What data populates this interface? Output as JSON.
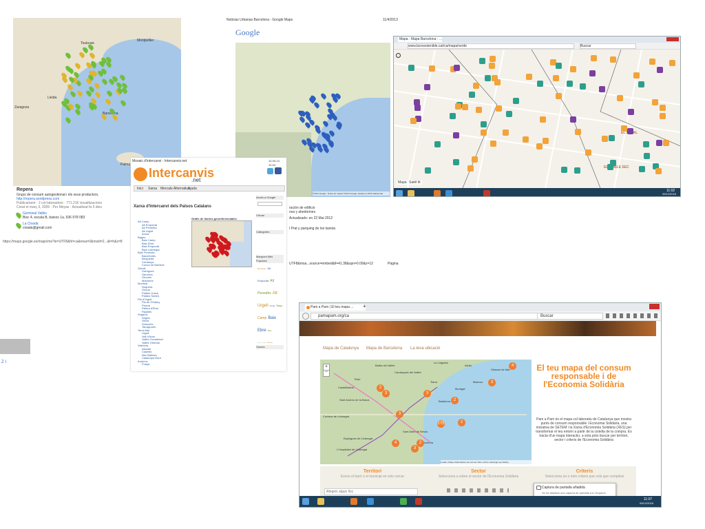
{
  "repera": {
    "map_labels": {
      "lleida": "Lleida",
      "zaragoza": "Zaragoza",
      "barcelona": "Barcelona",
      "toulouse": "Toulouse",
      "montpellier": "Montpellier",
      "palma": "Palma"
    },
    "title": "Repera",
    "desc": "Grups de consum autogestionat i els seus productors.",
    "url": "http://repera.wordpress.com",
    "meta": "Publicament · 2 col·laboradors · 771.216 visualitzacions",
    "meta2": "Creat el març 3, 2009 · Per Meyas · Actualitzat fa 5 dies",
    "item1_title": "Germinal Vallès",
    "item1_addr": "Bisc 4, escala B, baixos 1a, 936 978 083",
    "item2_title": "La Civada",
    "item2_email": "civada@gmail.com",
    "url_bar": "https://maps.google.es/maps/ms?ie=UTF8&hl=ca&msa=0&msid=2...&t=h&z=8"
  },
  "gmap_print": {
    "header_left": "Noticias Urbanas Barcelona - Google Maps",
    "header_right": "11/4/2013",
    "logo": "Google",
    "footer": "©2013 Google · Datos de mapas ©2013 Google, basado en BCN GEOportal",
    "notes": [
      "ración de edificio",
      "ova y ahedorines",
      "Actualizado: en 22 Mai 2012",
      "l Prat y parquing de los taxista"
    ],
    "url_line": "UTF8&msa...source=embed&ll=41.38&spn=0.09&z=12",
    "page": "Página"
  },
  "intercanvis": {
    "tab_title": "Mosaic d'intercanvi - Intercanvis.net",
    "date": "10-05-14 12:34",
    "logo_main": "Intercanvis",
    "logo_sub": ".net",
    "nav": [
      "Inici",
      "Xarxa",
      "Mercats Alternatius",
      "Ajuda"
    ],
    "page_title": "Xarxa d'Intercanvi dels Països Catalans",
    "map_title": "Gràfic de Xarxes georeferenciades",
    "sidebar_headers": [
      "Accés a Google",
      "Cercar",
      "Categories",
      "Marques Més Populars",
      "Xarxes"
    ],
    "tree_items": [
      "Alt Camp",
      "Alt Empordà",
      "Alt Penedès",
      "Alt Urgell",
      "Anoia",
      "Bages",
      "Baix Camp",
      "Baix Ebre",
      "Baix Empordà",
      "Baix Llobregat",
      "Baix Penedès",
      "Barcelonès",
      "Berguedà",
      "Cerdanya",
      "Conca de Barberà",
      "Garraf",
      "Garrigues",
      "Garrotxa",
      "Gironès",
      "Maresme",
      "Montsià",
      "Noguera",
      "Osona",
      "Pallars Jussà",
      "Pallars Sobirà",
      "Pla d'Urgell",
      "Pla de l'Estany",
      "Priorat",
      "Ribera d'Ebre",
      "Ripollès",
      "Segarra",
      "Segrià",
      "Selva",
      "Solsonès",
      "Tarragonès",
      "Terra Alta",
      "Urgell",
      "Vall d'Aran",
      "Vallès Occidental",
      "Vallès Oriental",
      "València",
      "Alacant",
      "Castelló",
      "Illes Balears",
      "Catalunya Nord",
      "Andorra",
      "Franja"
    ]
  },
  "bcn_browser": {
    "tab": "Mapa - Mapa Barcelona - ...",
    "url": "www.bcnsostenible.cat/ca/mapa/verde",
    "search": "Buscar",
    "map_labels": {
      "raval": "EL RAVAL",
      "poble_sec": "EL POBLE SEC"
    },
    "bottom_tabs": [
      "Mapa",
      "Satèl·lit"
    ],
    "clock": "11:02",
    "clock_date": "09/12/2016",
    "colors": {
      "orange": "#f2a33a",
      "teal": "#2e9e8c",
      "purple": "#7a3fa0"
    }
  },
  "pamapam": {
    "tab": "Pam a Pam | El teu mapa ...",
    "url": "pamapam.org/ca",
    "search": "Buscar",
    "tabs": [
      "Mapa de Catalunya",
      "Mapa de Barcelona",
      "La teva ubicació"
    ],
    "hero_title": "El teu mapa del consum responsable i de l'Economia Solidària",
    "hero_text": "Pam a Pam és el mapa col·laboratiu de Catalunya que mostra punts de consum responsable i Economia Solidària, una iniciativa de SETEM i la Xarxa d'Economia Solidària (XES) per transformar el teu entorn a partir de la cistella de la compra. Es tracta d'un mapa interactiu: a sota pots buscar per territori, sector i criteris de l'Economia Solidària",
    "map_credit": "Leaflet | Mapa d'alternatives de consum Pam a Pam maintingut per Dabne",
    "map_towns": [
      "Badia del Vallès",
      "Cardanyola del Vallès",
      "Castellbisbal",
      "Rubí",
      "Sant Andreu de la Barca",
      "Corbera de Llobregat",
      "Esplugues de Llobregat",
      "L'Hospitalet de Llobregat",
      "Sant Adrià de Besòs",
      "Badalona",
      "Barcelona",
      "Montgat",
      "Masnou",
      "Vilassar de Mar",
      "Tiana",
      "Alella",
      "La Llagosta"
    ],
    "clusters": [
      "3",
      "3",
      "2",
      "3",
      "4",
      "2",
      "275",
      "2",
      "3",
      "4",
      "3",
      "2"
    ],
    "filters": [
      {
        "title": "Territori",
        "sub": "Escriu el barri o el municipi on vols cercar",
        "placeholder": "Afegeix algun lloc"
      },
      {
        "title": "Sector",
        "sub": "Selecciona a sobre el sector de l'Economia Solidària"
      },
      {
        "title": "Criteris",
        "sub": "Selecciona un o més criteris que vols que compleixi"
      }
    ],
    "toast_title": "Captura de pantalla añadida",
    "toast_text": "Se ha añadido una captura de pantalla a tu Dropbox.",
    "clock": "11:07",
    "clock_date": "09/12/2016"
  },
  "left_fragment": "Z I"
}
